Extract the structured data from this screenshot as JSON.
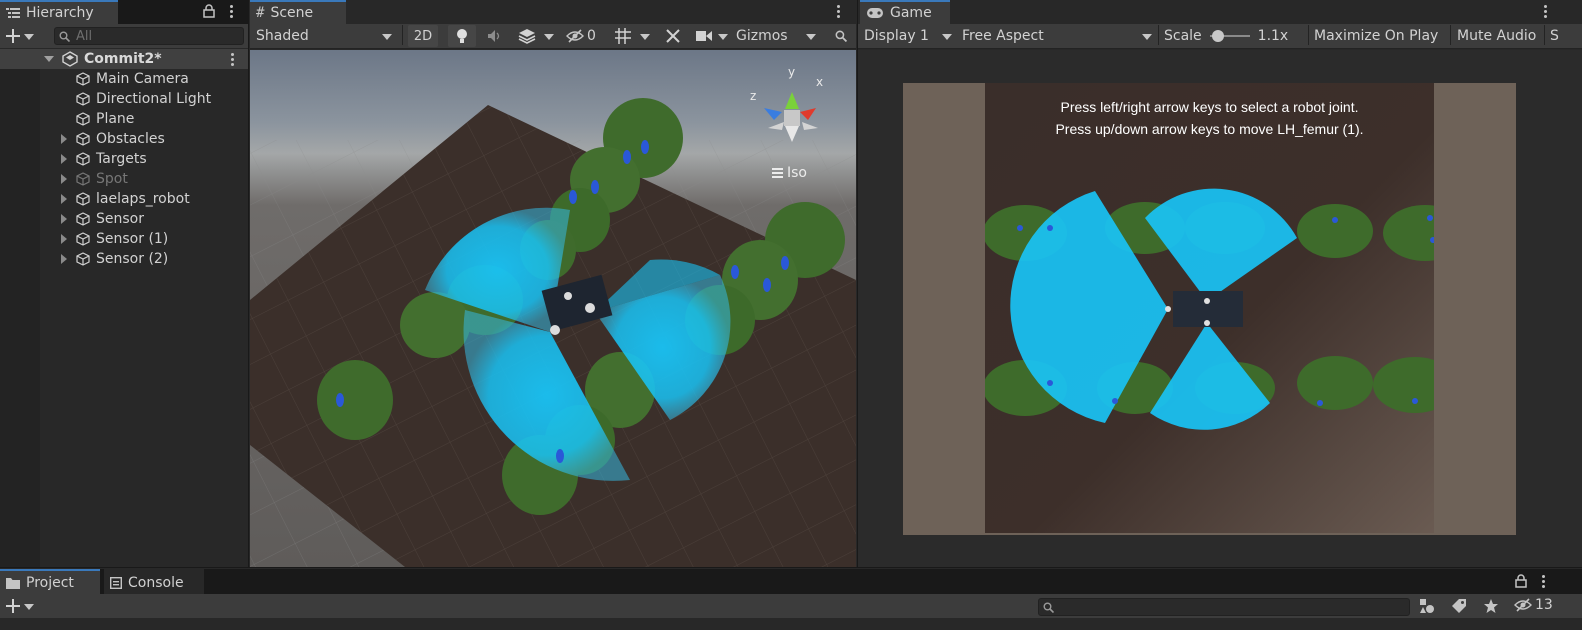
{
  "hierarchy": {
    "tab_label": "Hierarchy",
    "search_placeholder": "All",
    "scene_name": "Commit2*",
    "items": [
      {
        "label": "Main Camera",
        "foldout": false,
        "dimmed": false
      },
      {
        "label": "Directional Light",
        "foldout": false,
        "dimmed": false
      },
      {
        "label": "Plane",
        "foldout": false,
        "dimmed": false
      },
      {
        "label": "Obstacles",
        "foldout": true,
        "dimmed": false
      },
      {
        "label": "Targets",
        "foldout": true,
        "dimmed": false
      },
      {
        "label": "Spot",
        "foldout": true,
        "dimmed": true
      },
      {
        "label": "laelaps_robot",
        "foldout": true,
        "dimmed": false
      },
      {
        "label": "Sensor",
        "foldout": true,
        "dimmed": false
      },
      {
        "label": "Sensor (1)",
        "foldout": true,
        "dimmed": false
      },
      {
        "label": "Sensor (2)",
        "foldout": true,
        "dimmed": false
      }
    ]
  },
  "scene": {
    "tab_label": "Scene",
    "shading_mode": "Shaded",
    "mode_2d": "2D",
    "hidden_count": "0",
    "gizmos_label": "Gizmos",
    "projection_label": "Iso",
    "axis_labels": {
      "x": "x",
      "y": "y",
      "z": "z"
    }
  },
  "game": {
    "tab_label": "Game",
    "display": "Display 1",
    "aspect": "Free Aspect",
    "scale_label": "Scale",
    "scale_value": "1.1x",
    "scale_fraction": 0.1,
    "maximize_label": "Maximize On Play",
    "mute_label": "Mute Audio",
    "overflow_label": "S",
    "instruction_line1": "Press left/right arrow keys to select a robot joint.",
    "instruction_line2": "Press up/down arrow keys to move LH_femur (1)."
  },
  "project": {
    "tab_label": "Project",
    "console_label": "Console",
    "hidden_count": "13"
  },
  "colors": {
    "accent_tab": "#3a79bb",
    "sensor_cyan": "#19c3f5",
    "ground": "#3b2f2a"
  }
}
